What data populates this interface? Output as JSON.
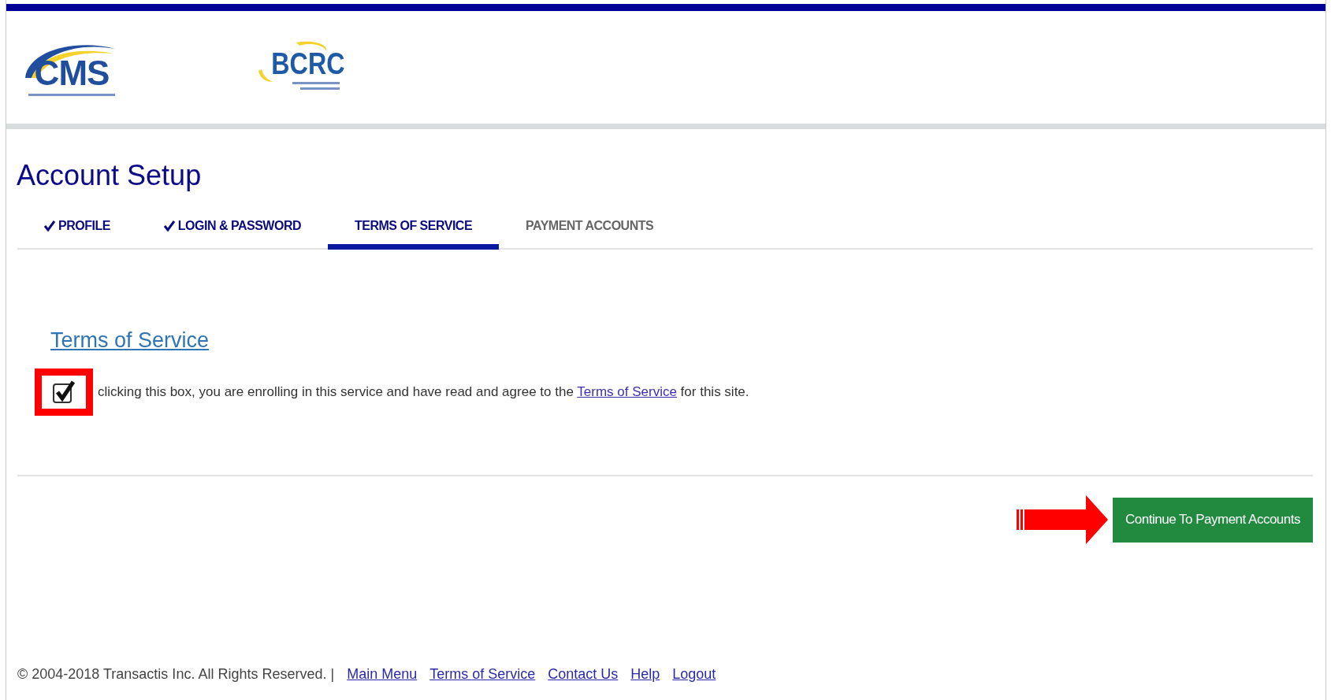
{
  "header": {
    "logos": [
      {
        "kind": "cms",
        "text": "CMS"
      },
      {
        "kind": "bcrc",
        "text": "BCRC"
      }
    ]
  },
  "title": "Account Setup",
  "tabs": [
    {
      "label": "PROFILE",
      "done": true,
      "selected": false
    },
    {
      "label": "LOGIN & PASSWORD",
      "done": true,
      "selected": false
    },
    {
      "label": "TERMS OF SERVICE",
      "done": false,
      "selected": true
    },
    {
      "label": "PAYMENT ACCOUNTS",
      "done": false,
      "selected": false
    }
  ],
  "terms": {
    "heading": "Terms of Service",
    "checked": true,
    "highlighted": true,
    "prefix": "clicking this box, you are enrolling in this service and have read and agree to the",
    "link": "Terms of Service",
    "suffix": "for this site."
  },
  "continue_button": "Continue To Payment Accounts",
  "footer": {
    "copyright": "© 2004-2018 Transactis Inc. All Rights Reserved. |",
    "links": [
      "Main Menu",
      "Terms of Service",
      "Contact Us",
      "Help",
      "Logout"
    ]
  }
}
